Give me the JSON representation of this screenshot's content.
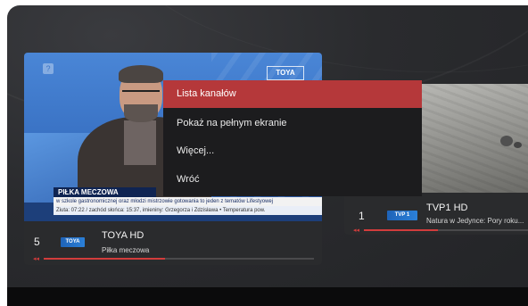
{
  "menu": {
    "items": [
      {
        "label": "Lista kanałów",
        "active": true
      },
      {
        "label": "Pokaż na pełnym ekranie",
        "active": false
      },
      {
        "label": "Więcej...",
        "active": false
      },
      {
        "label": "Wróć",
        "active": false
      }
    ]
  },
  "left_channel": {
    "number": "5",
    "logo_text": "TOYA",
    "name": "TOYA HD",
    "program": "Piłka meczowa",
    "progress": 0.45,
    "overlay": {
      "studio_logo": "TOYA",
      "title": "PIŁKA MECZOWA",
      "ticker1": "w szkole gastronomicznej oraz młodzi mistrzowie gotowania to jeden z tematów Lifestyowej",
      "ticker2": "Ziuta: 07:22 / zachód słońca: 15:37, imieniny: Grzegorza i Zdzisława    • Temperatura pow."
    }
  },
  "right_channel": {
    "number": "1",
    "logo_text": "TVP 1",
    "name": "TVP1 HD",
    "program": "Natura w Jedynce: Pory roku...",
    "progress": 0.45
  },
  "colors": {
    "accent": "#b5383a",
    "progress": "#d23c3c",
    "background": "#2a2b2e"
  }
}
